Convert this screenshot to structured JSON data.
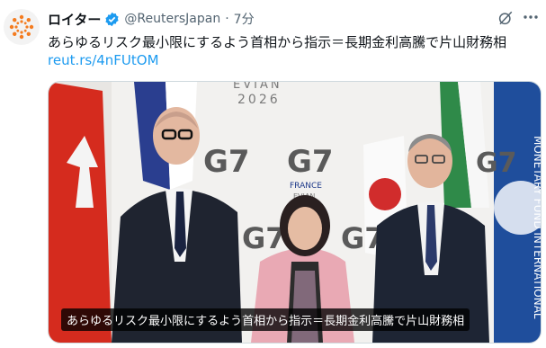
{
  "author": {
    "name": "ロイター",
    "handle": "@ReutersJapan",
    "separator": "·",
    "time": "7分",
    "brand_color": "#f47c20",
    "avatar_icon": "reuters-logo",
    "verified_color": "#1d9bf0"
  },
  "post": {
    "text": "あらゆるリスク最小限にするよう首相から指示＝長期金利高騰で片山財務相",
    "link": "reut.rs/4nFUtOM"
  },
  "media": {
    "caption": "あらゆるリスク最小限にするよう首相から指示＝長期金利高騰で片山財務相",
    "backdrop_text_top": "EVIAN",
    "backdrop_year": "2026",
    "g7_mark": "G7",
    "g7_label": "FRANCE",
    "g7_sub": "EVIAN",
    "imf_text": "MONETARY FUND INTERNATIONAL"
  },
  "icons": {
    "grok": "grok-icon",
    "more": "more-icon"
  }
}
